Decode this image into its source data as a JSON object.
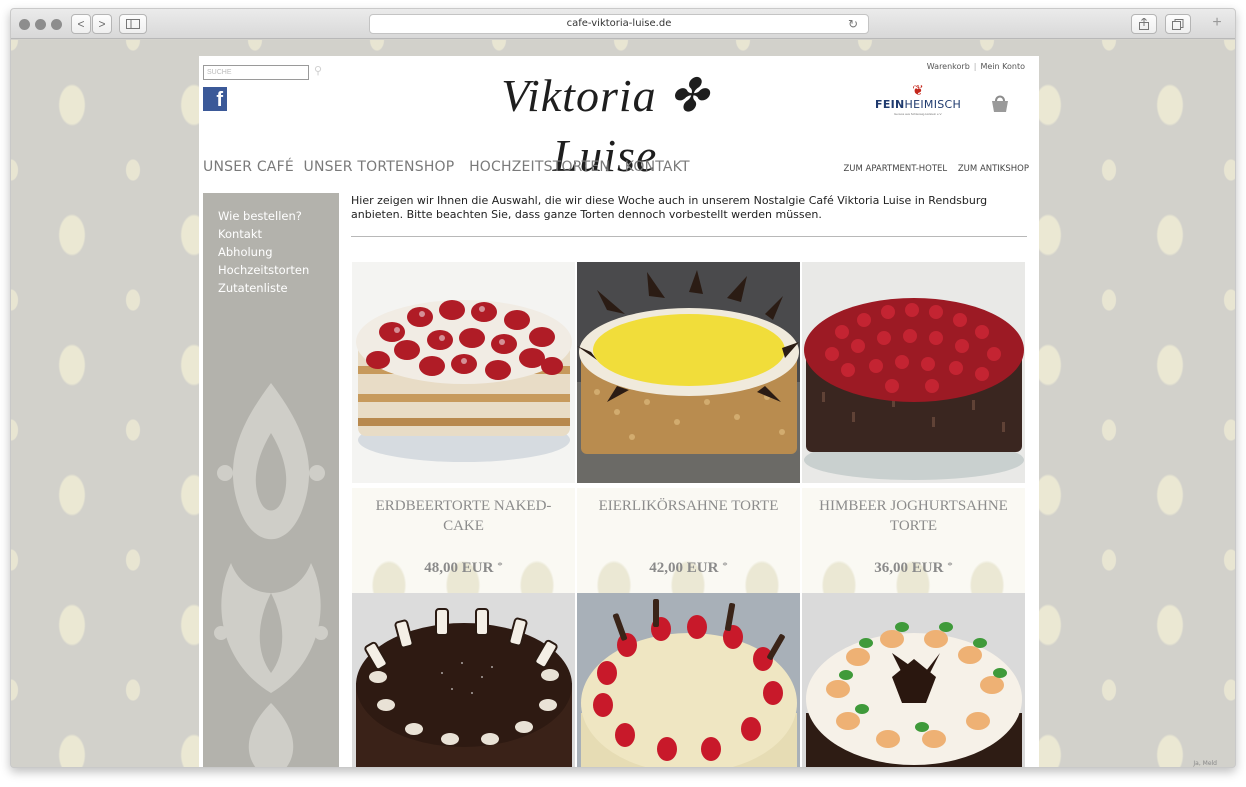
{
  "browser": {
    "url": "cafe-viktoria-luise.de",
    "back_label": "<",
    "forward_label": ">"
  },
  "header": {
    "search_placeholder": "SUCHE",
    "facebook_label": "f",
    "logo_text": "Viktoria ✤ Luise",
    "toplinks": [
      "Warenkorb",
      "Mein Konto"
    ],
    "feinheimisch": {
      "brand_bold": "FEIN",
      "brand_rest": "HEIMISCH",
      "tagline": "Genuss aus Schleswig-Holstein e.V."
    }
  },
  "nav": {
    "main": [
      "UNSER CAFÉ",
      "UNSER TORTENSHOP",
      "HOCHZEITSTORTEN",
      "KONTAKT"
    ],
    "secondary": [
      "ZUM APARTMENT-HOTEL",
      "ZUM ANTIKSHOP"
    ]
  },
  "sidebar": {
    "items": [
      "Wie bestellen?",
      "Kontakt",
      "Abholung",
      "Hochzeitstorten",
      "Zutatenliste"
    ]
  },
  "content": {
    "intro": "Hier zeigen wir Ihnen die Auswahl, die wir diese Woche auch in unserem Nostalgie Café Viktoria Luise in Rendsburg anbieten. Bitte beachten Sie, dass ganze Torten dennoch vorbestellt werden müssen.",
    "products": [
      {
        "name": "ERDBEERTORTE NAKED-CAKE",
        "price": "48,00 EUR",
        "price_suffix": "*"
      },
      {
        "name": "EIERLIKÖRSAHNE TORTE",
        "price": "42,00 EUR",
        "price_suffix": "*"
      },
      {
        "name": "HIMBEER JOGHURTSAHNE TORTE",
        "price": "36,00 EUR",
        "price_suffix": "*"
      }
    ]
  },
  "footer": {
    "cookie_text": "Ja, Meld"
  },
  "colors": {
    "page_bg": "#d2d1cb",
    "sidebar_bg": "#b3b2ac",
    "facebook": "#3b5998",
    "feinheimisch_red": "#c4261b",
    "feinheimisch_blue": "#1f3a6e"
  }
}
